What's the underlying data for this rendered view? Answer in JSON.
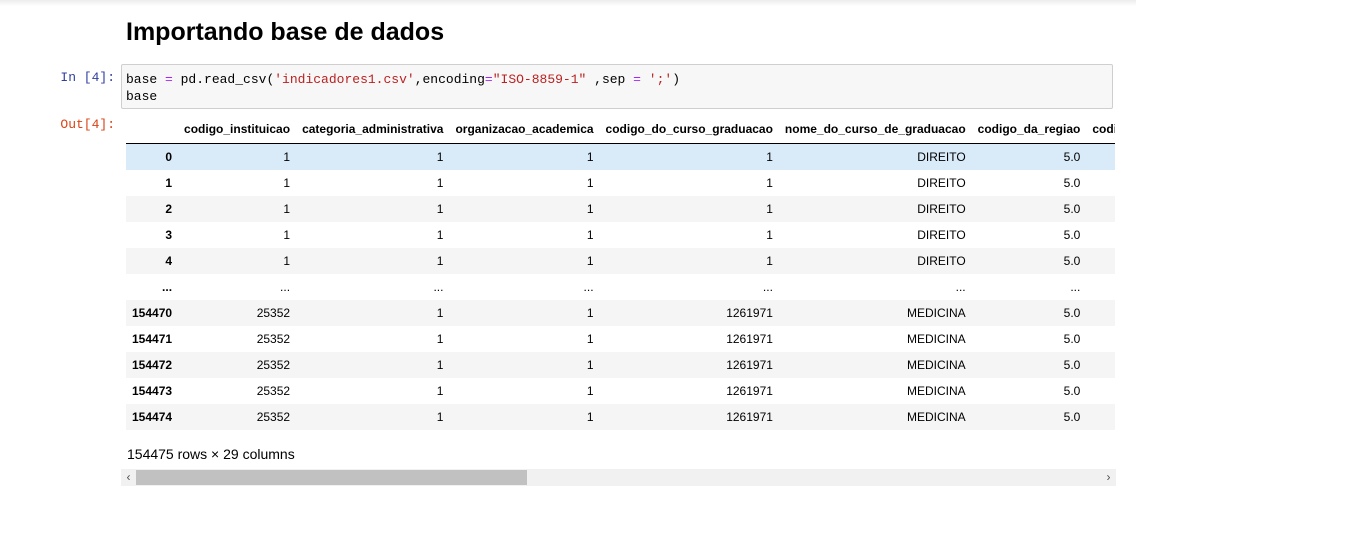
{
  "heading": "Importando base de dados",
  "in_prompt": "In [4]:",
  "out_prompt": "Out[4]:",
  "code": {
    "line1": {
      "a": "base ",
      "b": "=",
      "c": " pd.read_csv(",
      "d": "'indicadores1.csv'",
      "e": ",encoding",
      "f": "=",
      "g": "\"ISO-8859-1\"",
      "h": " ,sep ",
      "i": "=",
      "j": " ",
      "k": "';'",
      "l": ")"
    },
    "line2": "base"
  },
  "table": {
    "columns": [
      "codigo_instituicao",
      "categoria_administrativa",
      "organizacao_academica",
      "codigo_do_curso_graduacao",
      "nome_do_curso_de_graduacao",
      "codigo_da_regiao",
      "codi"
    ],
    "rows": [
      {
        "idx": "0",
        "cells": [
          "1",
          "1",
          "1",
          "1",
          "DIREITO",
          "5.0",
          ""
        ]
      },
      {
        "idx": "1",
        "cells": [
          "1",
          "1",
          "1",
          "1",
          "DIREITO",
          "5.0",
          ""
        ]
      },
      {
        "idx": "2",
        "cells": [
          "1",
          "1",
          "1",
          "1",
          "DIREITO",
          "5.0",
          ""
        ]
      },
      {
        "idx": "3",
        "cells": [
          "1",
          "1",
          "1",
          "1",
          "DIREITO",
          "5.0",
          ""
        ]
      },
      {
        "idx": "4",
        "cells": [
          "1",
          "1",
          "1",
          "1",
          "DIREITO",
          "5.0",
          ""
        ]
      },
      {
        "idx": "...",
        "cells": [
          "...",
          "...",
          "...",
          "...",
          "...",
          "...",
          ""
        ]
      },
      {
        "idx": "154470",
        "cells": [
          "25352",
          "1",
          "1",
          "1261971",
          "MEDICINA",
          "5.0",
          ""
        ]
      },
      {
        "idx": "154471",
        "cells": [
          "25352",
          "1",
          "1",
          "1261971",
          "MEDICINA",
          "5.0",
          ""
        ]
      },
      {
        "idx": "154472",
        "cells": [
          "25352",
          "1",
          "1",
          "1261971",
          "MEDICINA",
          "5.0",
          ""
        ]
      },
      {
        "idx": "154473",
        "cells": [
          "25352",
          "1",
          "1",
          "1261971",
          "MEDICINA",
          "5.0",
          ""
        ]
      },
      {
        "idx": "154474",
        "cells": [
          "25352",
          "1",
          "1",
          "1261971",
          "MEDICINA",
          "5.0",
          ""
        ]
      }
    ],
    "highlighted_row": 0
  },
  "row_count": "154475 rows × 29 columns",
  "scrollbar": {
    "left_icon": "chevron-left-icon",
    "right_icon": "chevron-right-icon",
    "left_glyph": "‹",
    "right_glyph": "›"
  }
}
